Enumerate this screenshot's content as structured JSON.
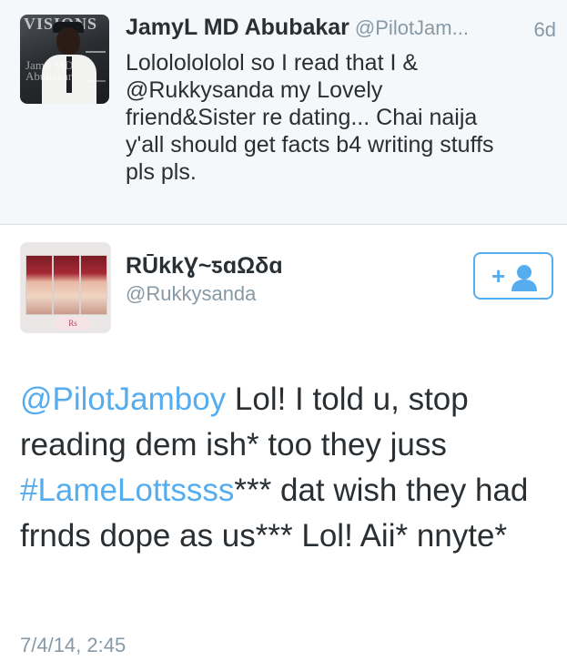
{
  "parent_tweet": {
    "author_name": "JamyL MD Abubakar",
    "author_handle": "@PilotJam...",
    "time_ago": "6d",
    "text": "Lolololololol so I read that I &\n@Rukkysanda my Lovely\nfriend&Sister re dating... Chai naija\ny'all should get facts b4 writing stuffs\npls pls.",
    "avatar_icon": "profile-photo",
    "avatar_lettering": {
      "magazine": "VISIONS",
      "cover_name": "Jamil MD Abubakar"
    }
  },
  "main_tweet": {
    "author_name": "RŪkkƔ~ƽɑΩδɑ",
    "author_handle": "@Rukkysanda",
    "avatar_icon": "profile-photo",
    "avatar_lettering": "Rs",
    "follow_button": {
      "label": "+",
      "icon": "add-user-icon",
      "color": "#55acee"
    },
    "text": {
      "mention": "@PilotJamboy",
      "part1": " Lol! I told u, stop reading dem ish* too they juss ",
      "hashtag": "#LameLottssss",
      "part2": "*** dat wish they had frnds dope as us*** Lol! Aii* nnyte*"
    },
    "timestamp": "7/4/14, 2:45"
  },
  "colors": {
    "link": "#55acee",
    "secondary_text": "#8899a6",
    "primary_text": "#292f33",
    "parent_background": "#f5f8fa"
  }
}
